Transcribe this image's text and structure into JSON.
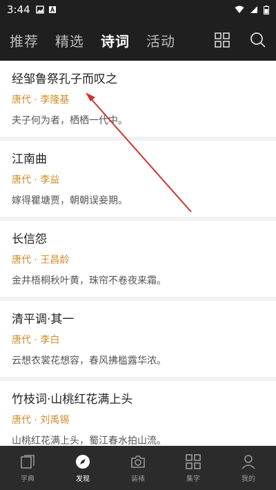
{
  "status": {
    "time": "3:44"
  },
  "top_nav": {
    "tabs": [
      {
        "label": "推荐",
        "active": false
      },
      {
        "label": "精选",
        "active": false
      },
      {
        "label": "诗词",
        "active": true
      },
      {
        "label": "活动",
        "active": false
      }
    ],
    "icons": [
      "grid-icon",
      "search-icon"
    ]
  },
  "poems": [
    {
      "title": "经邹鲁祭孔子而叹之",
      "author": "唐代 · 李隆基",
      "line": "夫子何为者，栖栖一代中。"
    },
    {
      "title": "江南曲",
      "author": "唐代 · 李益",
      "line": "嫁得瞿塘贾，朝朝误妾期。"
    },
    {
      "title": "长信怨",
      "author": "唐代 · 王昌龄",
      "line": "金井梧桐秋叶黄，珠帘不卷夜来霜。"
    },
    {
      "title": "清平调·其一",
      "author": "唐代 · 李白",
      "line": "云想衣裳花想容，春风拂槛露华浓。"
    },
    {
      "title": "竹枝词·山桃红花满上头",
      "author": "唐代 · 刘禹锡",
      "line": "山桃红花满上头，蜀江春水拍山流。"
    }
  ],
  "bottom_nav": {
    "items": [
      {
        "label": "字典",
        "icon": "book-icon",
        "active": false
      },
      {
        "label": "发现",
        "icon": "compass-icon",
        "active": true
      },
      {
        "label": "装裱",
        "icon": "camera-icon",
        "active": false
      },
      {
        "label": "集字",
        "icon": "grid-icon",
        "active": false
      },
      {
        "label": "我的",
        "icon": "person-icon",
        "active": false
      }
    ]
  },
  "colors": {
    "author": "#d18d2b",
    "annotation_arrow": "#d0312d",
    "nav_bg": "#1f1f1f",
    "bottom_bg": "#2b2b2b"
  }
}
